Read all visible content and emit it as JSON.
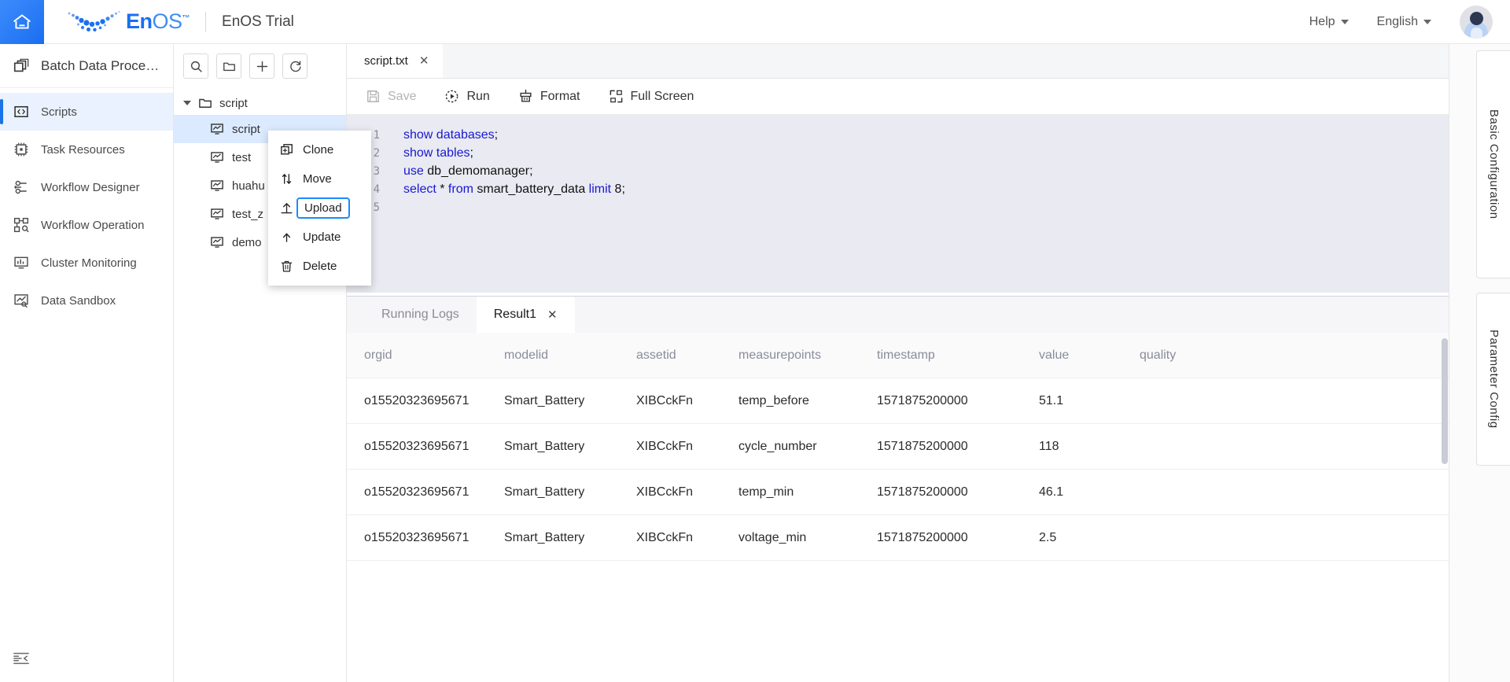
{
  "topbar": {
    "home_icon": "home-icon",
    "brand_en": "En",
    "brand_os": "OS",
    "brand_tm": "™",
    "product_title": "EnOS Trial",
    "help_label": "Help",
    "language_label": "English",
    "avatar_alt": "user-avatar"
  },
  "sidebar": {
    "header_label": "Batch Data Proce…",
    "header_icon": "stacked-layers-icon",
    "items": [
      {
        "label": "Scripts",
        "icon": "code-brackets-icon",
        "active": true
      },
      {
        "label": "Task Resources",
        "icon": "chip-icon",
        "active": false
      },
      {
        "label": "Workflow Designer",
        "icon": "flow-nodes-icon",
        "active": false
      },
      {
        "label": "Workflow Operation",
        "icon": "workflow-search-icon",
        "active": false
      },
      {
        "label": "Cluster Monitoring",
        "icon": "monitor-chart-icon",
        "active": false
      },
      {
        "label": "Data Sandbox",
        "icon": "sandbox-icon",
        "active": false
      }
    ],
    "collapse_icon": "collapse-sidebar-icon"
  },
  "file_tree": {
    "tools": [
      {
        "name": "search-icon",
        "title": "Search"
      },
      {
        "name": "folder-icon",
        "title": "New Folder"
      },
      {
        "name": "plus-icon",
        "title": "New"
      },
      {
        "name": "refresh-icon",
        "title": "Refresh"
      }
    ],
    "root": {
      "label": "script",
      "expanded": true,
      "icon": "folder-icon"
    },
    "files": [
      {
        "label": "script",
        "icon": "script-file-icon",
        "selected": true
      },
      {
        "label": "test",
        "icon": "script-file-icon",
        "selected": false
      },
      {
        "label": "huahu",
        "icon": "script-file-icon",
        "selected": false
      },
      {
        "label": "test_z",
        "icon": "script-file-icon",
        "selected": false
      },
      {
        "label": "demo",
        "icon": "script-file-icon",
        "selected": false
      }
    ]
  },
  "context_menu": {
    "items": [
      {
        "label": "Clone",
        "icon": "clone-icon",
        "focused": false
      },
      {
        "label": "Move",
        "icon": "move-icon",
        "focused": false
      },
      {
        "label": "Upload",
        "icon": "upload-icon",
        "focused": true
      },
      {
        "label": "Update",
        "icon": "update-icon",
        "focused": false
      },
      {
        "label": "Delete",
        "icon": "trash-icon",
        "focused": false
      }
    ]
  },
  "editor": {
    "tab_label": "script.txt",
    "tab_close": "✕",
    "toolbar": [
      {
        "label": "Save",
        "icon": "save-icon",
        "disabled": true
      },
      {
        "label": "Run",
        "icon": "run-icon",
        "disabled": false
      },
      {
        "label": "Format",
        "icon": "format-brush-icon",
        "disabled": false
      },
      {
        "label": "Full Screen",
        "icon": "fullscreen-icon",
        "disabled": false
      }
    ],
    "lines": [
      {
        "n": "1",
        "segments": [
          {
            "t": "show databases",
            "k": true
          },
          {
            "t": ";",
            "k": false
          }
        ]
      },
      {
        "n": "2",
        "segments": [
          {
            "t": "show tables",
            "k": true
          },
          {
            "t": ";",
            "k": false
          }
        ]
      },
      {
        "n": "3",
        "segments": [
          {
            "t": "use ",
            "k": true
          },
          {
            "t": "db_demomanager;",
            "k": false
          }
        ]
      },
      {
        "n": "4",
        "segments": [
          {
            "t": "select ",
            "k": true
          },
          {
            "t": "* ",
            "k": false
          },
          {
            "t": "from ",
            "k": true
          },
          {
            "t": "smart_battery_data ",
            "k": false
          },
          {
            "t": "limit",
            "k": true
          },
          {
            "t": " 8;",
            "k": false
          }
        ]
      },
      {
        "n": "5",
        "segments": []
      }
    ]
  },
  "results": {
    "tabs": [
      {
        "label": "Running Logs",
        "active": false,
        "closable": false
      },
      {
        "label": "Result1",
        "active": true,
        "closable": true,
        "close": "✕"
      }
    ],
    "columns": [
      "orgid",
      "modelid",
      "assetid",
      "measurepoints",
      "timestamp",
      "value",
      "quality"
    ],
    "rows": [
      [
        "o15520323695671",
        "Smart_Battery",
        "XIBCckFn",
        "temp_before",
        "1571875200000",
        "51.1",
        ""
      ],
      [
        "o15520323695671",
        "Smart_Battery",
        "XIBCckFn",
        "cycle_number",
        "1571875200000",
        "118",
        ""
      ],
      [
        "o15520323695671",
        "Smart_Battery",
        "XIBCckFn",
        "temp_min",
        "1571875200000",
        "46.1",
        ""
      ],
      [
        "o15520323695671",
        "Smart_Battery",
        "XIBCckFn",
        "voltage_min",
        "1571875200000",
        "2.5",
        ""
      ]
    ]
  },
  "right_rail": {
    "basic_label": "Basic Configuration",
    "param_label": "Parameter Config"
  },
  "colors": {
    "accent": "#1a73e8",
    "selected_row": "#dbeafe",
    "code_bg": "#e9eaf2",
    "keyword": "#1818d1",
    "focus_outline": "#1a8cff"
  }
}
